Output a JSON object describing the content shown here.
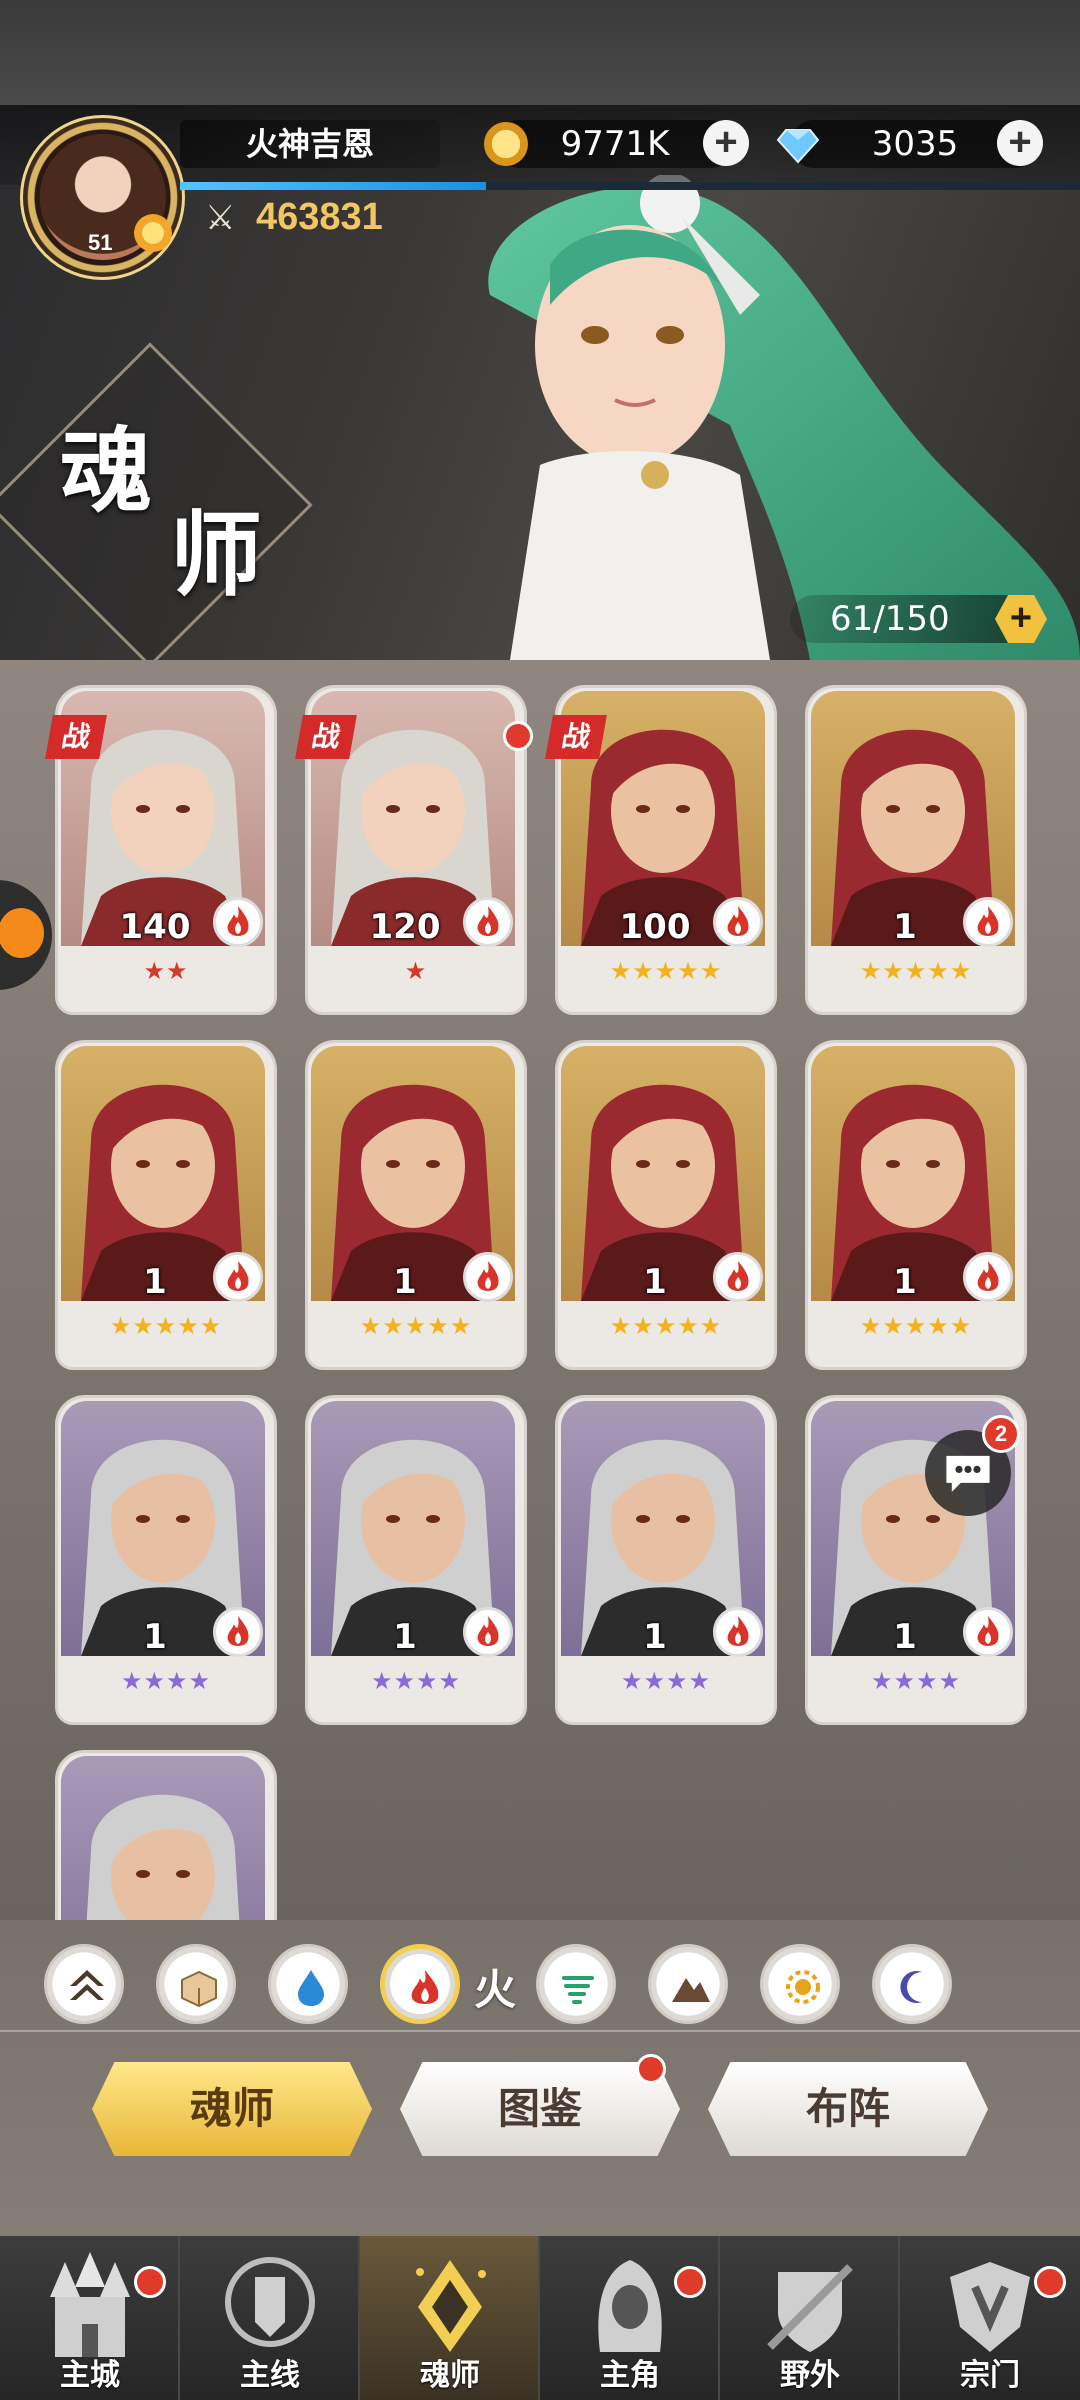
{
  "header": {
    "player_name": "火神吉恩",
    "player_level": "51",
    "power": "463831",
    "xp_fraction": 0.34,
    "gold": "9771K",
    "gems": "3035"
  },
  "banner": {
    "title_char_1": "魂",
    "title_char_2": "师",
    "capacity": "61/150"
  },
  "cards": [
    {
      "level": "140",
      "stars": "★★",
      "star_color": "red",
      "battle": "战",
      "bg": "red",
      "red_dot": false
    },
    {
      "level": "120",
      "stars": "★",
      "star_color": "red",
      "battle": "战",
      "bg": "red",
      "red_dot": true
    },
    {
      "level": "100",
      "stars": "★★★★★",
      "star_color": "gold",
      "battle": "战",
      "bg": "gold",
      "red_dot": false
    },
    {
      "level": "1",
      "stars": "★★★★★",
      "star_color": "gold",
      "battle": "",
      "bg": "gold",
      "red_dot": false
    },
    {
      "level": "1",
      "stars": "★★★★★",
      "star_color": "gold",
      "battle": "",
      "bg": "gold",
      "red_dot": false
    },
    {
      "level": "1",
      "stars": "★★★★★",
      "star_color": "gold",
      "battle": "",
      "bg": "gold",
      "red_dot": false
    },
    {
      "level": "1",
      "stars": "★★★★★",
      "star_color": "gold",
      "battle": "",
      "bg": "gold",
      "red_dot": false
    },
    {
      "level": "1",
      "stars": "★★★★★",
      "star_color": "gold",
      "battle": "",
      "bg": "gold",
      "red_dot": false
    },
    {
      "level": "1",
      "stars": "★★★★",
      "star_color": "purple",
      "battle": "",
      "bg": "purple",
      "red_dot": false
    },
    {
      "level": "1",
      "stars": "★★★★",
      "star_color": "purple",
      "battle": "",
      "bg": "purple",
      "red_dot": false
    },
    {
      "level": "1",
      "stars": "★★★★",
      "star_color": "purple",
      "battle": "",
      "bg": "purple",
      "red_dot": false
    },
    {
      "level": "1",
      "stars": "★★★★",
      "star_color": "purple",
      "battle": "",
      "bg": "purple",
      "red_dot": false
    },
    {
      "level": "",
      "stars": "",
      "star_color": "purple",
      "battle": "",
      "bg": "purple",
      "red_dot": false
    }
  ],
  "chat": {
    "badge": "2"
  },
  "filters": {
    "items": [
      "all-icon",
      "box-icon",
      "water-icon",
      "fire-icon",
      "wind-icon",
      "earth-icon",
      "light-icon",
      "dark-icon"
    ],
    "active_label": "火"
  },
  "subtabs": [
    "魂师",
    "图鉴",
    "布阵"
  ],
  "nav": [
    "主城",
    "主线",
    "魂师",
    "主角",
    "野外",
    "宗门"
  ],
  "colors": {
    "accent": "#f2c661",
    "badge": "#e03a2a",
    "active_tab": "#e8b739"
  }
}
